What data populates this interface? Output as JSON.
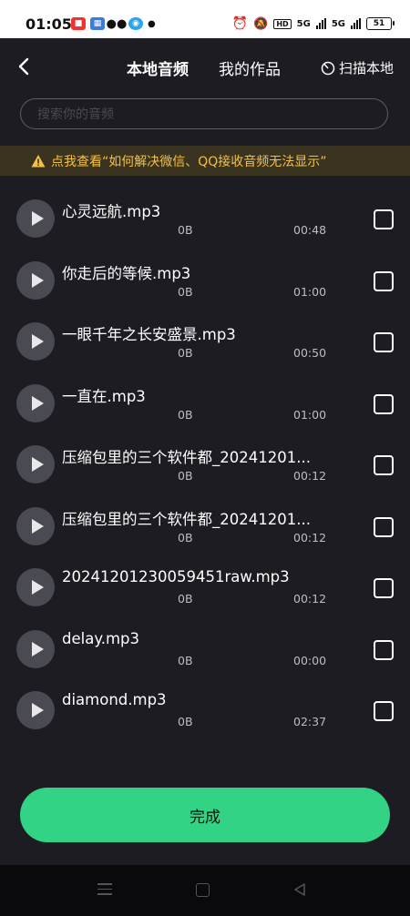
{
  "status_bar": {
    "time": "01:05",
    "battery": "51",
    "network1": "5G",
    "network2": "5G",
    "hd": "HD"
  },
  "header": {
    "tabs": [
      {
        "label": "本地音频"
      },
      {
        "label": "我的作品"
      }
    ],
    "scan_label": "扫描本地"
  },
  "search": {
    "placeholder": "搜索你的音频",
    "value": ""
  },
  "notice": {
    "text": "点我查看“如何解决微信、QQ接收音频无法显示”"
  },
  "files": [
    {
      "name": "心灵远航.mp3",
      "size": "0B",
      "duration": "00:48",
      "checked": false
    },
    {
      "name": "你走后的等候.mp3",
      "size": "0B",
      "duration": "01:00",
      "checked": false
    },
    {
      "name": "一眼千年之长安盛景.mp3",
      "size": "0B",
      "duration": "00:50",
      "checked": false
    },
    {
      "name": "一直在.mp3",
      "size": "0B",
      "duration": "01:00",
      "checked": false
    },
    {
      "name": "压缩包里的三个软件都_20241201...",
      "size": "0B",
      "duration": "00:12",
      "checked": false
    },
    {
      "name": "压缩包里的三个软件都_20241201...",
      "size": "0B",
      "duration": "00:12",
      "checked": false
    },
    {
      "name": "20241201230059451raw.mp3",
      "size": "0B",
      "duration": "00:12",
      "checked": false
    },
    {
      "name": "delay.mp3",
      "size": "0B",
      "duration": "00:00",
      "checked": false
    },
    {
      "name": "diamond.mp3",
      "size": "0B",
      "duration": "02:37",
      "checked": false
    }
  ],
  "done_button": {
    "label": "完成"
  },
  "colors": {
    "accent": "#33d386",
    "background": "#1c1c22",
    "notice_text": "#f3c148",
    "notice_bg": "#3a3320"
  }
}
